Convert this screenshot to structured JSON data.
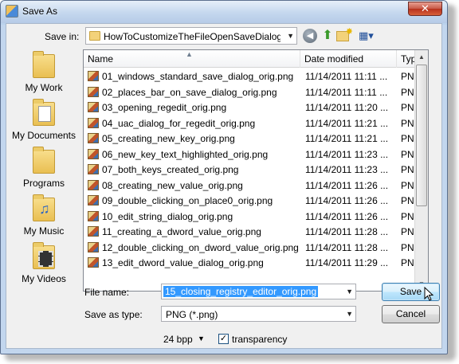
{
  "window": {
    "title": "Save As",
    "close_glyph": "✕"
  },
  "toolbar": {
    "save_in_label": "Save in:",
    "save_in_value": "HowToCustomizeTheFileOpenSaveDialogBox",
    "icons": [
      "back-icon",
      "up-folder-icon",
      "new-folder-icon",
      "view-menu-icon"
    ]
  },
  "places": [
    {
      "label": "My Work",
      "icon": "folder-icon"
    },
    {
      "label": "My Documents",
      "icon": "documents-icon"
    },
    {
      "label": "Programs",
      "icon": "folder-icon"
    },
    {
      "label": "My Music",
      "icon": "music-icon"
    },
    {
      "label": "My Videos",
      "icon": "videos-icon"
    }
  ],
  "file_list": {
    "columns": [
      "Name",
      "Date modified",
      "Type"
    ],
    "rows": [
      {
        "name": "01_windows_standard_save_dialog_orig.png",
        "date": "11/14/2011 11:11 ...",
        "type": "PNG im"
      },
      {
        "name": "02_places_bar_on_save_dialog_orig.png",
        "date": "11/14/2011 11:11 ...",
        "type": "PNG im"
      },
      {
        "name": "03_opening_regedit_orig.png",
        "date": "11/14/2011 11:20 ...",
        "type": "PNG im"
      },
      {
        "name": "04_uac_dialog_for_regedit_orig.png",
        "date": "11/14/2011 11:21 ...",
        "type": "PNG im"
      },
      {
        "name": "05_creating_new_key_orig.png",
        "date": "11/14/2011 11:21 ...",
        "type": "PNG im"
      },
      {
        "name": "06_new_key_text_highlighted_orig.png",
        "date": "11/14/2011 11:23 ...",
        "type": "PNG im"
      },
      {
        "name": "07_both_keys_created_orig.png",
        "date": "11/14/2011 11:23 ...",
        "type": "PNG im"
      },
      {
        "name": "08_creating_new_value_orig.png",
        "date": "11/14/2011 11:26 ...",
        "type": "PNG im"
      },
      {
        "name": "09_double_clicking_on_place0_orig.png",
        "date": "11/14/2011 11:26 ...",
        "type": "PNG im"
      },
      {
        "name": "10_edit_string_dialog_orig.png",
        "date": "11/14/2011 11:26 ...",
        "type": "PNG im"
      },
      {
        "name": "11_creating_a_dword_value_orig.png",
        "date": "11/14/2011 11:28 ...",
        "type": "PNG im"
      },
      {
        "name": "12_double_clicking_on_dword_value_orig.png",
        "date": "11/14/2011 11:28 ...",
        "type": "PNG im"
      },
      {
        "name": "13_edit_dword_value_dialog_orig.png",
        "date": "11/14/2011 11:29 ...",
        "type": "PNG im"
      }
    ]
  },
  "form": {
    "file_name_label": "File name:",
    "file_name_value": "15_closing_registry_editor_orig.png",
    "save_as_type_label": "Save as type:",
    "save_as_type_value": "PNG (*.png)",
    "save_button": "Save",
    "cancel_button": "Cancel",
    "bpp_value": "24 bpp",
    "transparency_label": "transparency",
    "transparency_checked": true
  },
  "colors": {
    "selection": "#3399ff",
    "title_bar": "#c4d7ee",
    "close_button": "#c75846"
  }
}
